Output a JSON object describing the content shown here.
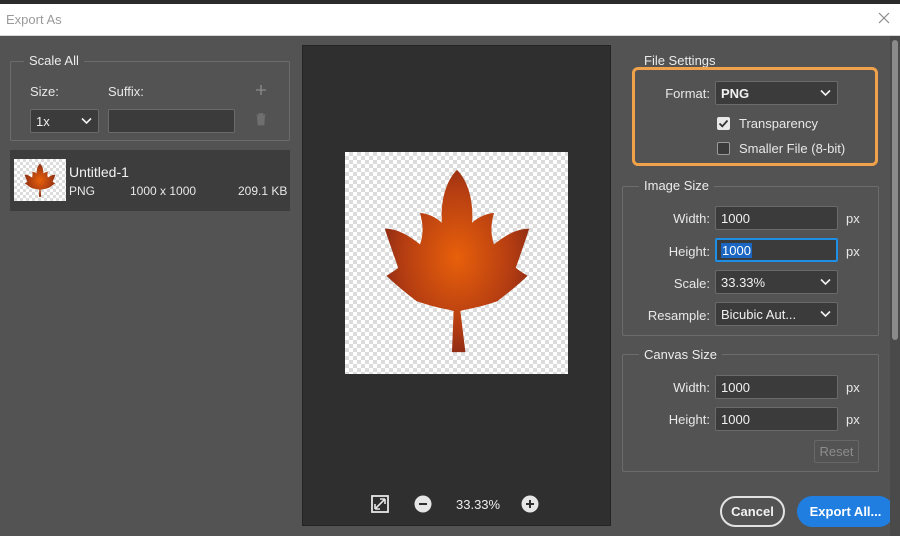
{
  "window": {
    "title": "Export As"
  },
  "scale_all": {
    "heading": "Scale All",
    "size_label": "Size:",
    "suffix_label": "Suffix:",
    "size_value": "1x",
    "suffix_value": ""
  },
  "asset": {
    "name": "Untitled-1",
    "format": "PNG",
    "dimensions": "1000 x 1000",
    "filesize": "209.1 KB"
  },
  "preview": {
    "zoom": "33.33%"
  },
  "file_settings": {
    "heading": "File Settings",
    "format_label": "Format:",
    "format_value": "PNG",
    "transparency_label": "Transparency",
    "transparency_checked": true,
    "smaller_file_label": "Smaller File (8-bit)",
    "smaller_file_checked": false
  },
  "image_size": {
    "heading": "Image Size",
    "width_label": "Width:",
    "width_value": "1000",
    "height_label": "Height:",
    "height_value": "1000",
    "scale_label": "Scale:",
    "scale_value": "33.33%",
    "resample_label": "Resample:",
    "resample_value": "Bicubic Aut...",
    "unit": "px"
  },
  "canvas_size": {
    "heading": "Canvas Size",
    "width_label": "Width:",
    "width_value": "1000",
    "height_label": "Height:",
    "height_value": "1000",
    "unit": "px",
    "reset_label": "Reset"
  },
  "footer": {
    "cancel_label": "Cancel",
    "export_label": "Export All..."
  },
  "colors": {
    "accent": "#1f7ee0",
    "highlight": "#f0a24a",
    "leaf_center": "#e8600a",
    "leaf_edge": "#8a2a14"
  }
}
